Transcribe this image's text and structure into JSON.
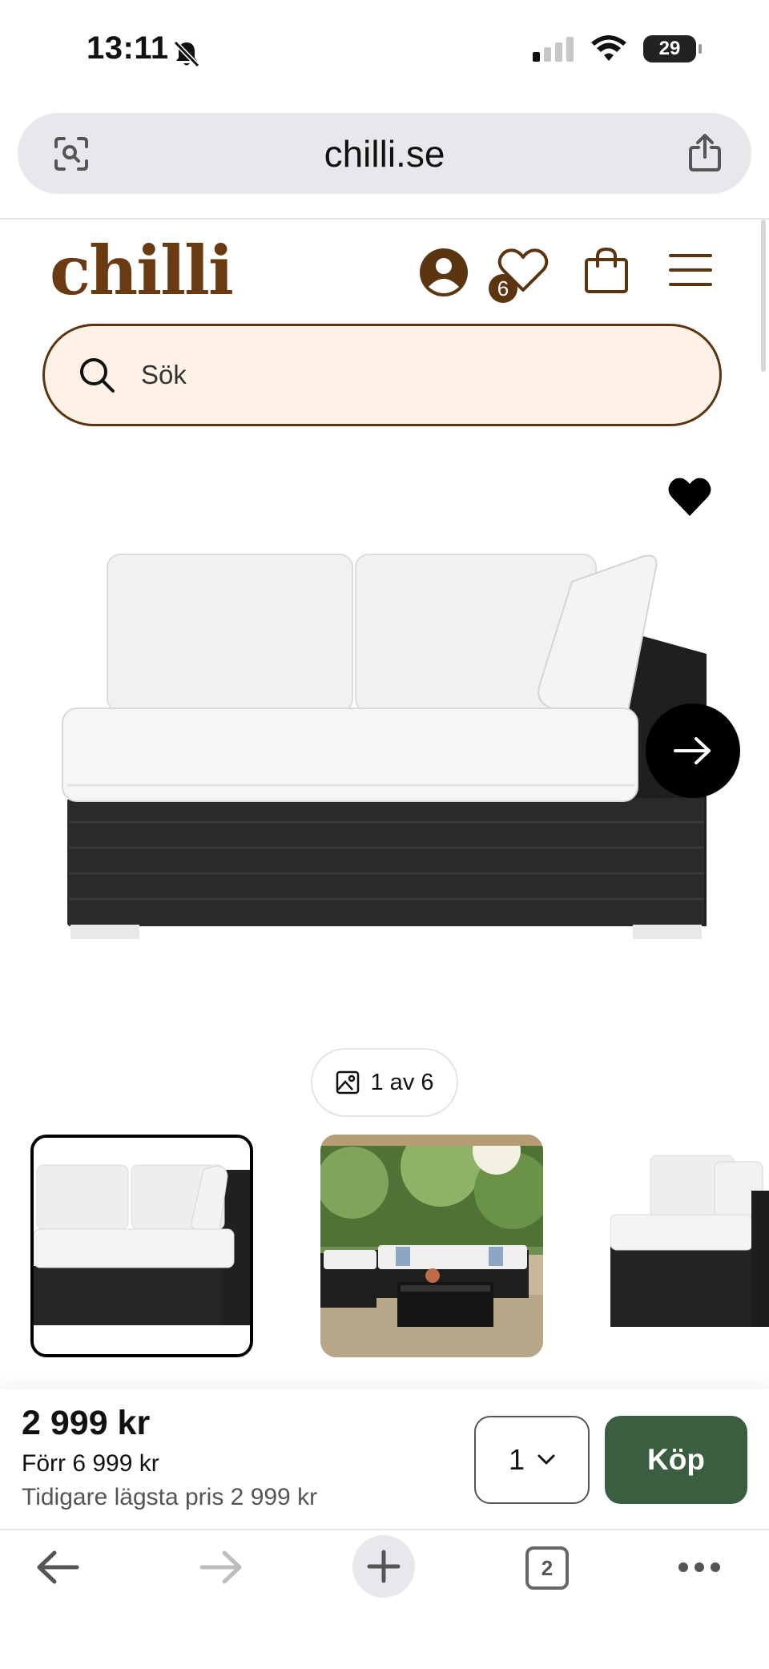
{
  "status_bar": {
    "time": "13:11",
    "battery": "29",
    "battery_level": 0.29
  },
  "browser": {
    "url": "chilli.se"
  },
  "site": {
    "logo": "chilli",
    "wishlist_count": "6",
    "search_placeholder": "Sök"
  },
  "gallery": {
    "counter": "1 av 6"
  },
  "buy": {
    "price": "2 999 kr",
    "price_before": "Förr 6 999 kr",
    "lowest_price": "Tidigare lägsta pris 2 999 kr",
    "quantity": "1",
    "buy_label": "Köp"
  },
  "toolbar": {
    "tab_count": "2"
  },
  "colors": {
    "brand_brown": "#5b3410",
    "search_bg": "#fef1e6",
    "buy_green": "#3a5e3f"
  }
}
